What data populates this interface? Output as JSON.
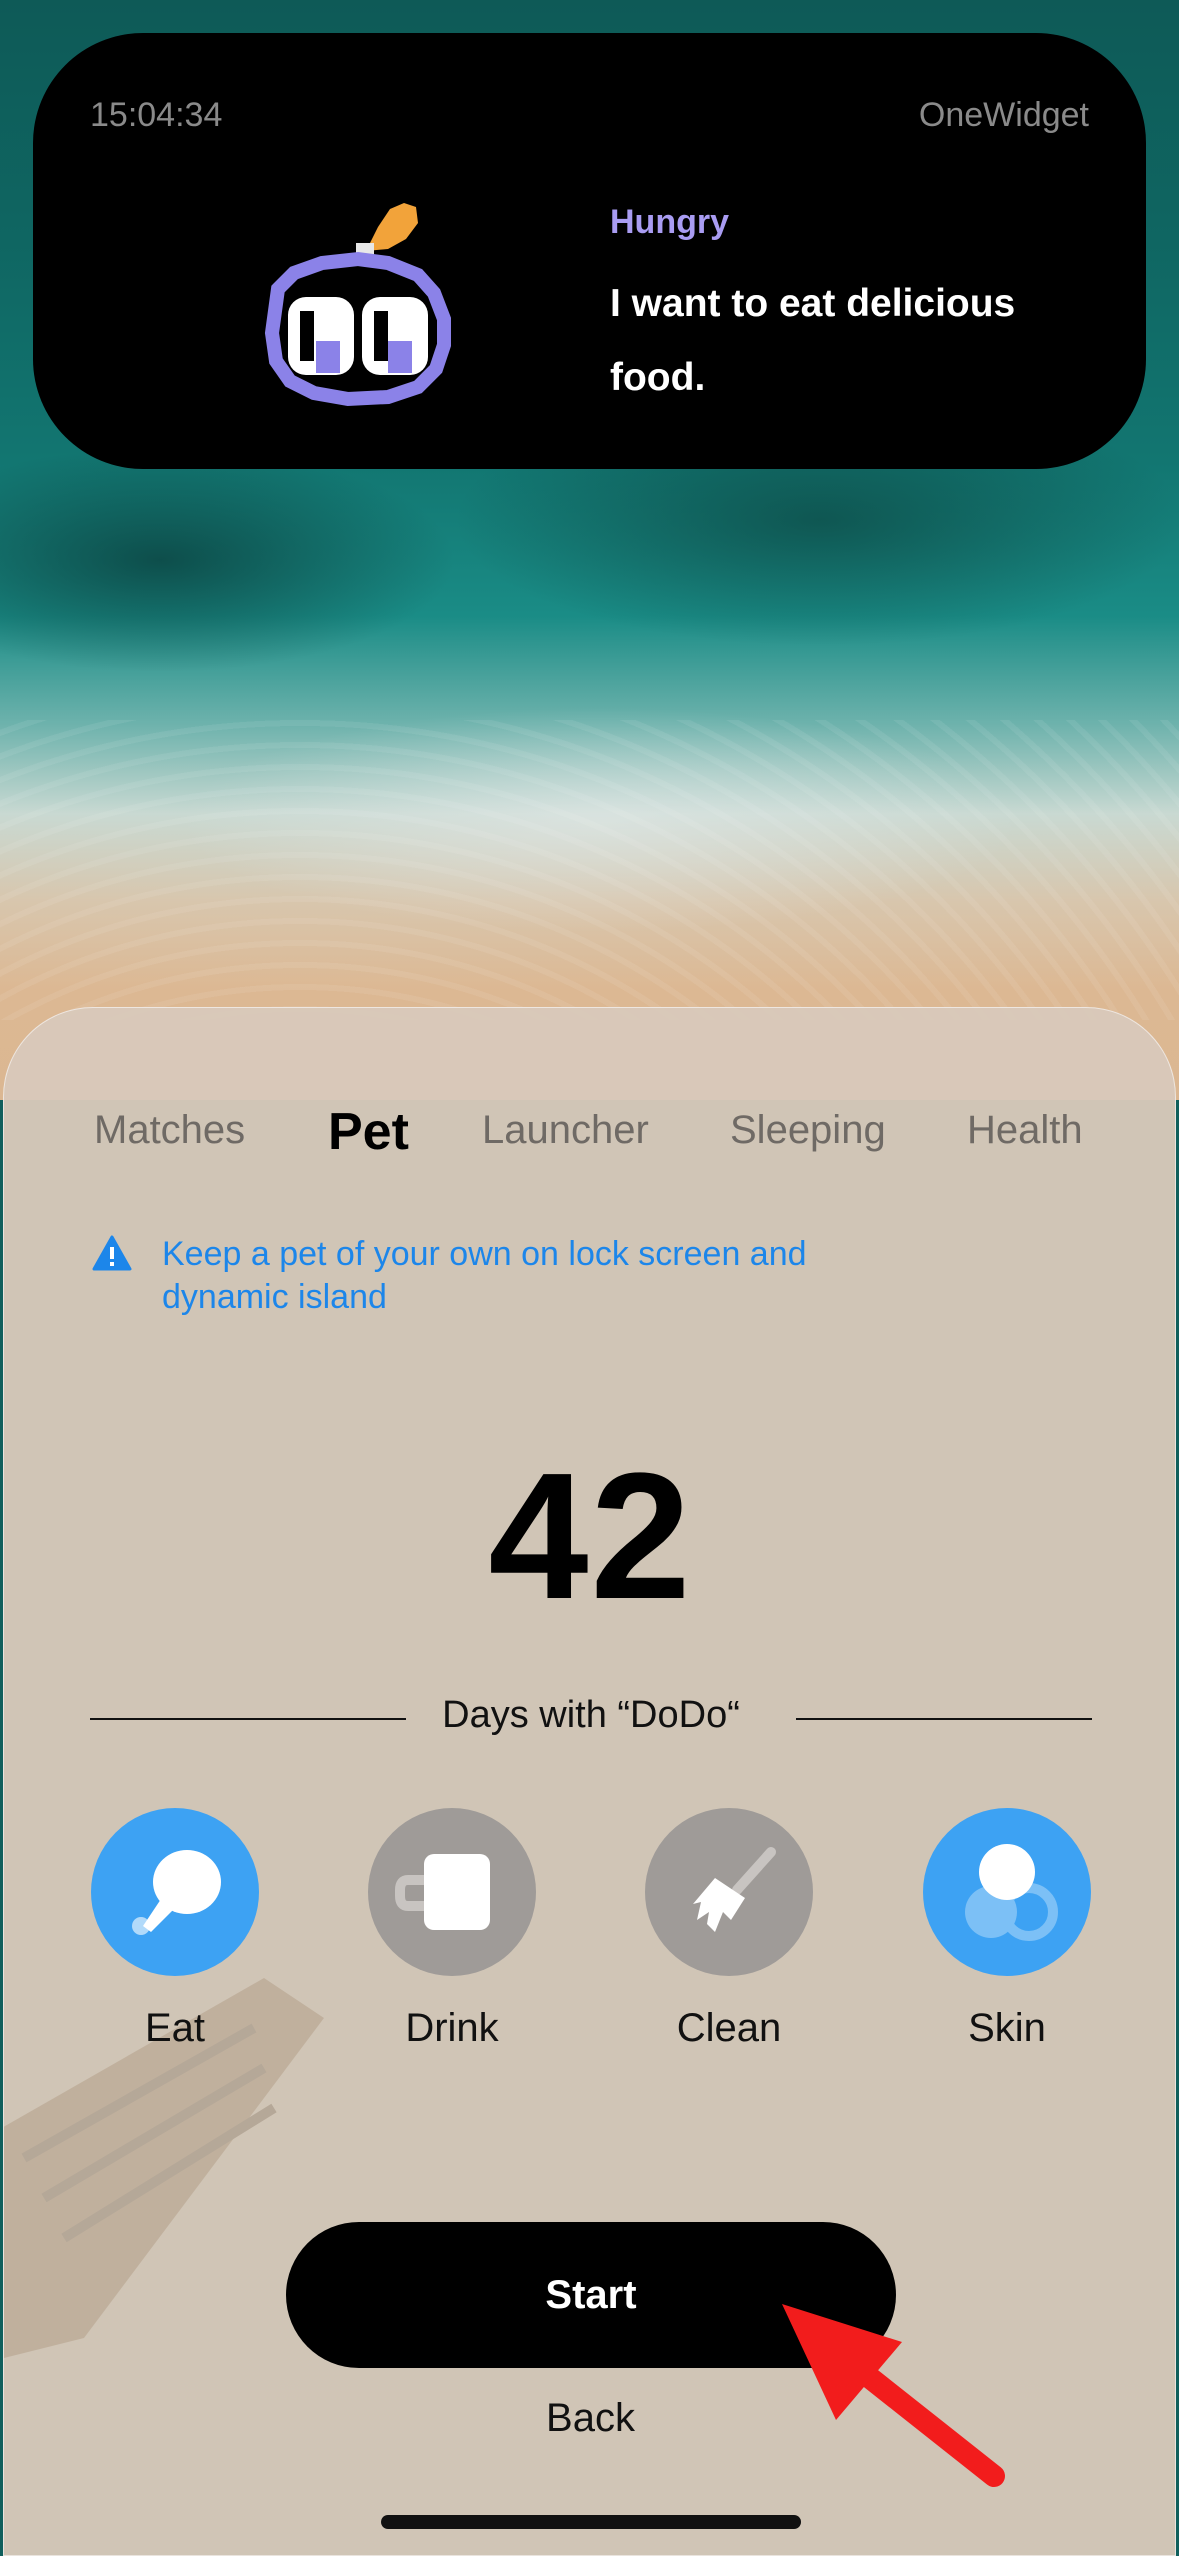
{
  "island": {
    "time": "15:04:34",
    "app_name": "OneWidget",
    "status": "Hungry",
    "message": "I want to eat delicious food.",
    "status_color": "#a99cf2"
  },
  "tabs": [
    {
      "label": "Matches",
      "active": false
    },
    {
      "label": "Pet",
      "active": true
    },
    {
      "label": "Launcher",
      "active": false
    },
    {
      "label": "Sleeping",
      "active": false
    },
    {
      "label": "Health",
      "active": false
    }
  ],
  "notice": {
    "icon": "warning-triangle-icon",
    "text": "Keep a pet of your own on lock screen and dynamic island",
    "color": "#1c86ea"
  },
  "counter": {
    "value": "42",
    "label": "Days with “DoDo“"
  },
  "actions": [
    {
      "label": "Eat",
      "icon": "drumstick-icon",
      "state": "active",
      "color": "#3da2f3"
    },
    {
      "label": "Drink",
      "icon": "mug-icon",
      "state": "inactive",
      "color": "#9f9b98"
    },
    {
      "label": "Clean",
      "icon": "broom-icon",
      "state": "inactive",
      "color": "#9f9b98"
    },
    {
      "label": "Skin",
      "icon": "skin-circles-icon",
      "state": "active",
      "color": "#3da2f3"
    }
  ],
  "buttons": {
    "start": "Start",
    "back": "Back"
  }
}
